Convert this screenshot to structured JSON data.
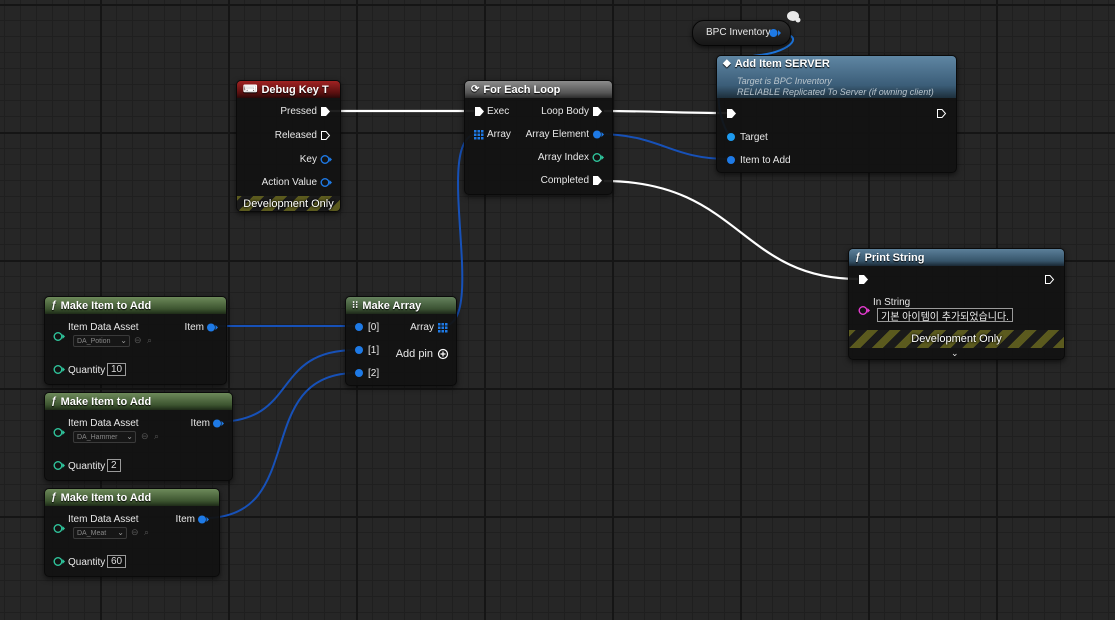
{
  "colors": {
    "exec": "#ffffff",
    "object": "#1e7ae6",
    "int": "#2fc59c",
    "string": "#e93cd3",
    "dev_stripe": "#5b5a1e"
  },
  "variable_node": {
    "label": "BPC Inventory"
  },
  "debug_key": {
    "title": "Debug Key T",
    "icon": "keyboard-icon",
    "pins": {
      "pressed": "Pressed",
      "released": "Released",
      "key": "Key",
      "action_value": "Action Value"
    },
    "footer": "Development Only"
  },
  "for_each": {
    "title": "For Each Loop",
    "icon": "loop-icon",
    "pins": {
      "exec": "Exec",
      "array": "Array",
      "loop_body": "Loop Body",
      "array_element": "Array Element",
      "array_index": "Array Index",
      "completed": "Completed"
    }
  },
  "add_item": {
    "title": "Add Item SERVER",
    "icon": "event-diamond-icon",
    "subtitle1": "Target is BPC Inventory",
    "subtitle2": "RELIABLE Replicated To Server (if owning client)",
    "pins": {
      "target": "Target",
      "item_to_add": "Item to Add"
    }
  },
  "print_string": {
    "title": "Print String",
    "icon": "function-icon",
    "pins": {
      "in_string": "In String"
    },
    "in_string_value": "기본 아이템이 추가되었습니다.",
    "footer": "Development Only"
  },
  "make_array": {
    "title": "Make Array",
    "icon": "array-grid-icon",
    "pins": {
      "in0": "[0]",
      "in1": "[1]",
      "in2": "[2]",
      "out": "Array",
      "add_pin": "Add pin"
    }
  },
  "make_items": [
    {
      "title": "Make Item to Add",
      "asset_label": "Item Data Asset",
      "asset_value": "DA_Potion",
      "quantity_label": "Quantity",
      "quantity": "10",
      "out": "Item"
    },
    {
      "title": "Make Item to Add",
      "asset_label": "Item Data Asset",
      "asset_value": "DA_Hammer",
      "quantity_label": "Quantity",
      "quantity": "2",
      "out": "Item"
    },
    {
      "title": "Make Item to Add",
      "asset_label": "Item Data Asset",
      "asset_value": "DA_Meat",
      "quantity_label": "Quantity",
      "quantity": "60",
      "out": "Item"
    }
  ]
}
